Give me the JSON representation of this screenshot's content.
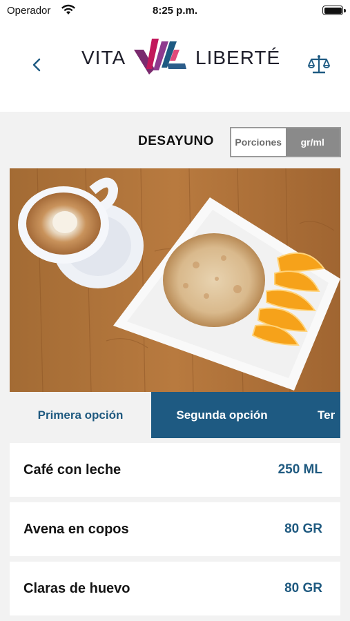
{
  "status_bar": {
    "carrier": "Operador",
    "time": "8:25 p.m."
  },
  "header": {
    "logo_left": "VITA",
    "logo_right": "LIBERTÉ",
    "icons": {
      "back": "chevron-left-icon",
      "scale": "scale-icon"
    }
  },
  "meal": {
    "title": "DESAYUNO",
    "unit_toggle": {
      "options": [
        "Porciones",
        "gr/ml"
      ],
      "selected": "gr/ml"
    }
  },
  "tabs": [
    {
      "label": "Primera opción",
      "active": false
    },
    {
      "label": "Segunda opción",
      "active": true
    },
    {
      "label": "Ter",
      "active": false
    }
  ],
  "items": [
    {
      "name": "Café con leche",
      "quantity": "250 ML"
    },
    {
      "name": "Avena en copos",
      "quantity": "80 GR"
    },
    {
      "name": "Claras de huevo",
      "quantity": "80 GR"
    }
  ],
  "colors": {
    "brand_blue": "#1e5a82",
    "background_gray": "#f2f2f2",
    "logo_purple": "#6b2d6b",
    "logo_pink": "#c2185b"
  }
}
